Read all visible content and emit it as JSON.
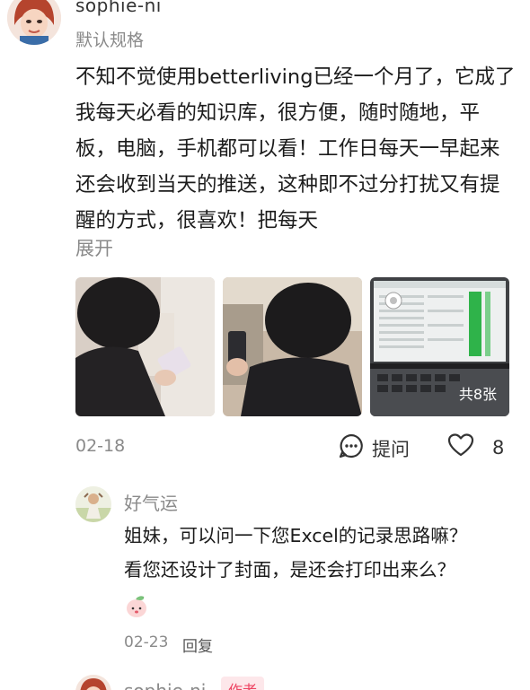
{
  "review": {
    "username": "sophie-ni",
    "spec": "默认规格",
    "text": "不知不觉使用betterliving已经一个月了，它成了我每天必看的知识库，很方便，随时随地，平板，电脑，手机都可以看！工作日每天一早起来还会收到当天的推送，这种即不过分打扰又有提醒的方式，很喜欢！把每天",
    "expand_label": "展开",
    "photo_count": "共8张",
    "date": "02-18",
    "ask_label": "提问",
    "like_count": "8"
  },
  "reply": {
    "username": "好气运",
    "text_line1": "姐妹，可以问一下您Excel的记录思路嘛？",
    "text_line2": "看您还设计了封面，是还会打印出来么？",
    "date": "02-23",
    "reply_label": "回复"
  },
  "next_reply": {
    "username": "sophie-ni",
    "author_tag": "作者"
  },
  "colors": {
    "like_stroke": "#333333",
    "author_tag_bg": "#fde7ea",
    "author_tag_text": "#ee4563",
    "sheet_green": "#2fb34a"
  }
}
